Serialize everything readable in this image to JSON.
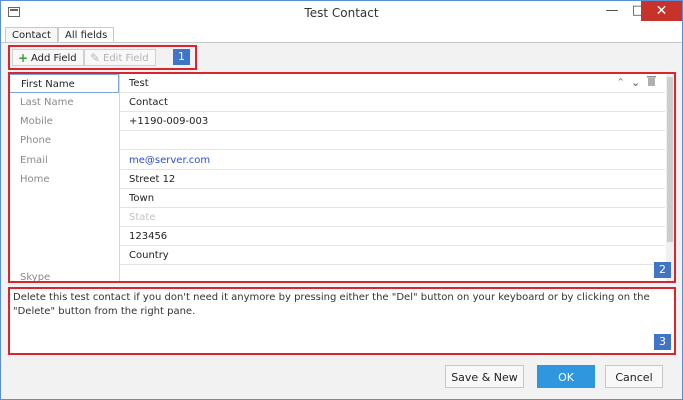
{
  "window": {
    "title": "Test Contact",
    "minimize_glyph": "—",
    "maximize_glyph": "□",
    "close_glyph": "✕"
  },
  "tabs": [
    {
      "label": "Contact"
    },
    {
      "label": "All fields"
    }
  ],
  "toolbar": {
    "add_field_label": "Add Field",
    "edit_field_label": "Edit Field"
  },
  "badges": {
    "toolbar": "1",
    "fields": "2",
    "description": "3"
  },
  "fields": [
    {
      "label": "First Name",
      "value": "Test"
    },
    {
      "label": "Last Name",
      "value": "Contact"
    },
    {
      "label": "Mobile",
      "value": "+1190-009-003"
    },
    {
      "label": "Phone",
      "value": ""
    },
    {
      "label": "Email",
      "value": "me@server.com"
    },
    {
      "label": "Home",
      "value": "Street 12"
    },
    {
      "label": "",
      "value": "Town"
    },
    {
      "label": "",
      "value": "State"
    },
    {
      "label": "",
      "value": "123456"
    },
    {
      "label": "",
      "value": "Country"
    },
    {
      "label": "Skype",
      "value": ""
    }
  ],
  "description": "Delete this test contact if you don't need it anymore by pressing either the \"Del\" button on your keyboard or by clicking on the \"Delete\" button from the right pane.",
  "buttons": {
    "save_new": "Save & New",
    "ok": "OK",
    "cancel": "Cancel"
  },
  "icons": {
    "app": "window-icon",
    "add": "plus-icon",
    "edit": "pencil-icon",
    "move_up": "chevron-up-icon",
    "move_down": "chevron-down-icon",
    "delete": "trash-icon"
  },
  "colors": {
    "accent": "#2e97dd",
    "highlight": "#d7262e",
    "badge": "#3f74c6",
    "link": "#2b4fcf",
    "close": "#c7332b"
  }
}
